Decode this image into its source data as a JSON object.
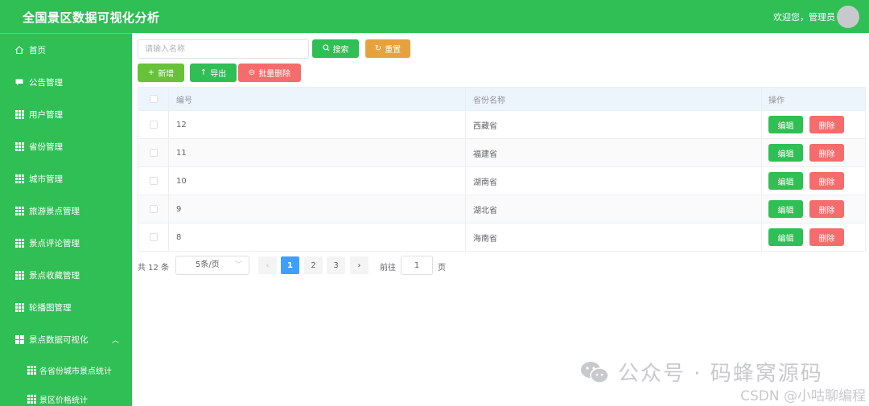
{
  "header": {
    "title": "全国景区数据可视化分析",
    "welcome": "欢迎您，管理员"
  },
  "sidebar": {
    "items": [
      {
        "label": "首页",
        "icon": "home-icon"
      },
      {
        "label": "公告管理",
        "icon": "message-icon"
      },
      {
        "label": "用户管理",
        "icon": "grid-icon"
      },
      {
        "label": "省份管理",
        "icon": "grid-icon"
      },
      {
        "label": "城市管理",
        "icon": "grid-icon"
      },
      {
        "label": "旅游景点管理",
        "icon": "grid-icon"
      },
      {
        "label": "景点评论管理",
        "icon": "grid-icon"
      },
      {
        "label": "景点收藏管理",
        "icon": "grid-icon"
      },
      {
        "label": "轮播图管理",
        "icon": "grid-icon"
      },
      {
        "label": "景点数据可视化",
        "icon": "menu-icon",
        "expanded": true
      }
    ],
    "subitems": [
      {
        "label": "各省份城市景点统计"
      },
      {
        "label": "景区价格统计"
      }
    ]
  },
  "toolbar": {
    "search_placeholder": "请输入名称",
    "search_label": "搜索",
    "reset_label": "重置",
    "add_label": "新增",
    "export_label": "导出",
    "batch_delete_label": "批量删除"
  },
  "table": {
    "headers": {
      "id": "编号",
      "province": "省份名称",
      "actions": "操作"
    },
    "edit_label": "编辑",
    "delete_label": "删除",
    "rows": [
      {
        "id": "12",
        "province": "西藏省"
      },
      {
        "id": "11",
        "province": "福建省"
      },
      {
        "id": "10",
        "province": "湖南省"
      },
      {
        "id": "9",
        "province": "湖北省"
      },
      {
        "id": "8",
        "province": "海南省"
      }
    ]
  },
  "pagination": {
    "total": "共 12 条",
    "page_size": "5条/页",
    "pages": [
      "1",
      "2",
      "3"
    ],
    "current": "1",
    "goto_label": "前往",
    "goto_value": "1",
    "goto_suffix": "页"
  },
  "watermark": {
    "line1": "公众号 · 码蜂窝源码",
    "line2": "CSDN @小咕聊编程"
  },
  "colors": {
    "primary": "#2fbf55",
    "warning": "#e6a23c",
    "danger": "#f56c6c",
    "success": "#67c23a",
    "page_active": "#409eff"
  }
}
